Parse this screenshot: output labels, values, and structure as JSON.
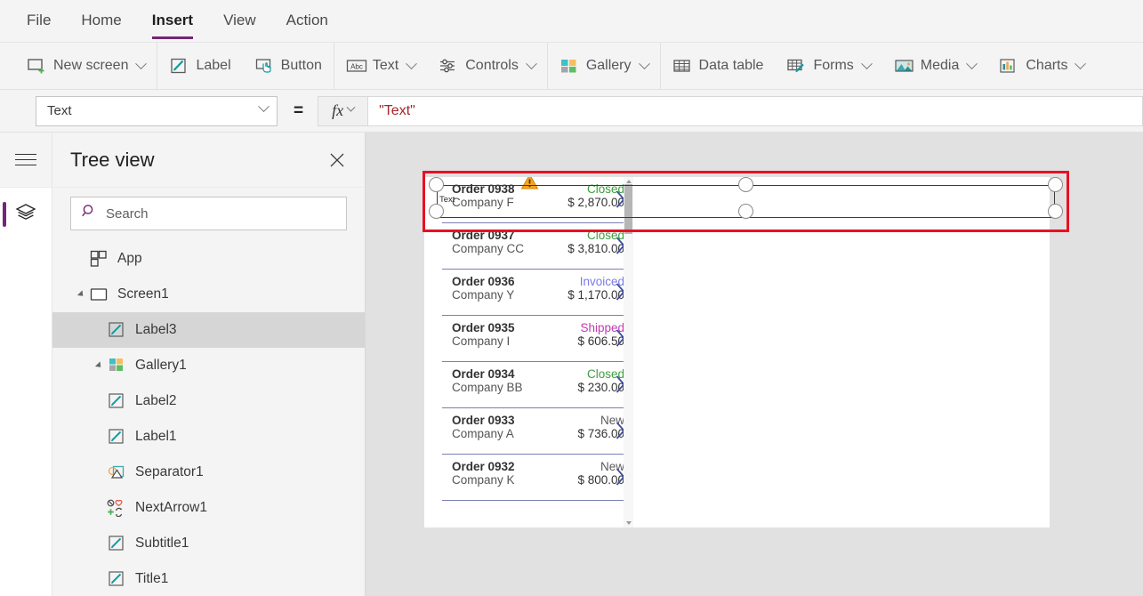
{
  "menu": {
    "items": [
      {
        "label": "File",
        "active": false
      },
      {
        "label": "Home",
        "active": false
      },
      {
        "label": "Insert",
        "active": true
      },
      {
        "label": "View",
        "active": false
      },
      {
        "label": "Action",
        "active": false
      }
    ]
  },
  "ribbon": {
    "items": [
      {
        "label": "New screen",
        "icon": "new-screen-icon",
        "caret": true
      },
      {
        "label": "Label",
        "icon": "label-icon",
        "caret": false
      },
      {
        "label": "Button",
        "icon": "button-icon",
        "caret": false
      },
      {
        "label": "Text",
        "icon": "text-abc-icon",
        "caret": true
      },
      {
        "label": "Controls",
        "icon": "controls-sliders-icon",
        "caret": true
      },
      {
        "label": "Gallery",
        "icon": "gallery-grid-icon",
        "caret": true
      },
      {
        "label": "Data table",
        "icon": "data-table-icon",
        "caret": false
      },
      {
        "label": "Forms",
        "icon": "forms-icon",
        "caret": true
      },
      {
        "label": "Media",
        "icon": "media-image-icon",
        "caret": true
      },
      {
        "label": "Charts",
        "icon": "charts-bar-icon",
        "caret": true
      }
    ]
  },
  "propertybar": {
    "property_value": "Text",
    "equals": "=",
    "fx_label": "fx",
    "formula_value": "\"Text\""
  },
  "rail": {
    "hamburger": "hamburger-icon",
    "items": [
      {
        "icon": "tree-view-layers-icon",
        "selected": true
      }
    ]
  },
  "treeview": {
    "title": "Tree view",
    "close": "close-icon",
    "search_placeholder": "Search",
    "search_value": "",
    "nodes": [
      {
        "label": "App",
        "icon": "app-icon",
        "level": 1,
        "twisty": "none",
        "selected": false
      },
      {
        "label": "Screen1",
        "icon": "screen-icon",
        "level": 1,
        "twisty": "expanded",
        "selected": false
      },
      {
        "label": "Label3",
        "icon": "label-icon",
        "level": 2,
        "twisty": "none",
        "selected": true
      },
      {
        "label": "Gallery1",
        "icon": "gallery-icon",
        "level": 2,
        "twisty": "expanded",
        "selected": false
      },
      {
        "label": "Label2",
        "icon": "label-icon",
        "level": 3,
        "twisty": "none",
        "selected": false
      },
      {
        "label": "Label1",
        "icon": "label-icon",
        "level": 3,
        "twisty": "none",
        "selected": false
      },
      {
        "label": "Separator1",
        "icon": "separator-icon",
        "level": 3,
        "twisty": "none",
        "selected": false
      },
      {
        "label": "NextArrow1",
        "icon": "icon-set-icon",
        "level": 3,
        "twisty": "none",
        "selected": false
      },
      {
        "label": "Subtitle1",
        "icon": "label-icon",
        "level": 3,
        "twisty": "none",
        "selected": false
      },
      {
        "label": "Title1",
        "icon": "label-icon",
        "level": 3,
        "twisty": "none",
        "selected": false
      }
    ]
  },
  "canvas": {
    "selected_control": {
      "name": "Label3",
      "text": "Text",
      "warning": "warning-triangle-icon",
      "selection_color": "#e81123"
    },
    "gallery": {
      "items": [
        {
          "title": "Order 0938",
          "subtitle": "Company F",
          "status": "Closed",
          "status_color": "#3c9d3c",
          "amount": "$ 2,870.00",
          "warning": true
        },
        {
          "title": "Order 0937",
          "subtitle": "Company CC",
          "status": "Closed",
          "status_color": "#3c9d3c",
          "amount": "$ 3,810.00",
          "warning": false
        },
        {
          "title": "Order 0936",
          "subtitle": "Company Y",
          "status": "Invoiced",
          "status_color": "#7a7ae6",
          "amount": "$ 1,170.00",
          "warning": false
        },
        {
          "title": "Order 0935",
          "subtitle": "Company I",
          "status": "Shipped",
          "status_color": "#c239b3",
          "amount": "$ 606.50",
          "warning": false
        },
        {
          "title": "Order 0934",
          "subtitle": "Company BB",
          "status": "Closed",
          "status_color": "#3c9d3c",
          "amount": "$ 230.00",
          "warning": false
        },
        {
          "title": "Order 0933",
          "subtitle": "Company A",
          "status": "New",
          "status_color": "#5a5a5a",
          "amount": "$ 736.00",
          "warning": false
        },
        {
          "title": "Order 0932",
          "subtitle": "Company K",
          "status": "New",
          "status_color": "#5a5a5a",
          "amount": "$ 800.00",
          "warning": false
        }
      ]
    }
  },
  "colors": {
    "accent": "#742774",
    "canvas_bg": "#e1e1e1",
    "panel_bg": "#f4f4f4",
    "formula_text": "#a4262c",
    "selection": "#e81123"
  }
}
